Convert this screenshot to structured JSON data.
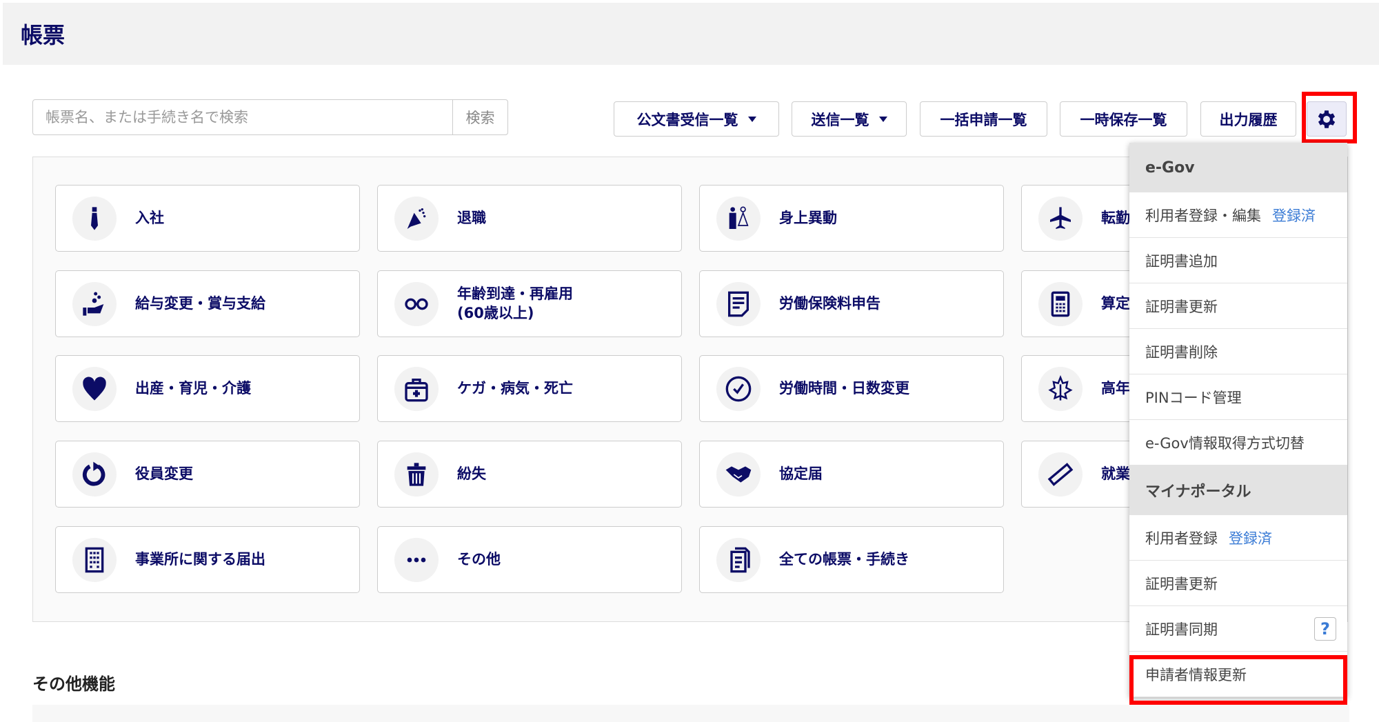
{
  "header": {
    "title": "帳票"
  },
  "search": {
    "placeholder": "帳票名、または手続き名で検索",
    "button": "検索"
  },
  "toolbar": {
    "buttons": [
      {
        "label": "公文書受信一覧",
        "dropdown": true
      },
      {
        "label": "送信一覧",
        "dropdown": true
      },
      {
        "label": "一括申請一覧",
        "dropdown": false
      },
      {
        "label": "一時保存一覧",
        "dropdown": false
      },
      {
        "label": "出力履歴",
        "dropdown": false
      }
    ],
    "settings_icon": "gear-icon"
  },
  "cards": [
    [
      {
        "label": "入社",
        "icon": "tie-icon"
      },
      {
        "label": "退職",
        "icon": "bouquet-icon"
      },
      {
        "label": "身上異動",
        "icon": "couple-icon"
      },
      {
        "label": "転勤",
        "icon": "airplane-icon"
      }
    ],
    [
      {
        "label": "給与変更・賞与支給",
        "icon": "hand-coins-icon"
      },
      {
        "label": "年齢到達・再雇用\n(60歳以上)",
        "icon": "glasses-icon"
      },
      {
        "label": "労働保険料申告",
        "icon": "document-icon"
      },
      {
        "label": "算定",
        "icon": "calculator-icon"
      }
    ],
    [
      {
        "label": "出産・育児・介護",
        "icon": "heart-icon"
      },
      {
        "label": "ケガ・病気・死亡",
        "icon": "first-aid-icon"
      },
      {
        "label": "労働時間・日数変更",
        "icon": "clock-icon"
      },
      {
        "label": "高年",
        "icon": "maple-leaf-icon"
      }
    ],
    [
      {
        "label": "役員変更",
        "icon": "refresh-icon"
      },
      {
        "label": "紛失",
        "icon": "trash-icon"
      },
      {
        "label": "協定届",
        "icon": "handshake-icon"
      },
      {
        "label": "就業",
        "icon": "ruler-icon"
      }
    ],
    [
      {
        "label": "事業所に関する届出",
        "icon": "building-icon"
      },
      {
        "label": "その他",
        "icon": "more-icon"
      },
      {
        "label": "全ての帳票・手続き",
        "icon": "documents-icon"
      }
    ]
  ],
  "other_section": {
    "title": "その他機能"
  },
  "settings_menu": {
    "sections": [
      {
        "title": "e-Gov",
        "items": [
          {
            "label": "利用者登録・編集",
            "badge": "登録済"
          },
          {
            "label": "証明書追加"
          },
          {
            "label": "証明書更新"
          },
          {
            "label": "証明書削除"
          },
          {
            "label": "PINコード管理"
          },
          {
            "label": "e-Gov情報取得方式切替"
          }
        ]
      },
      {
        "title": "マイナポータル",
        "items": [
          {
            "label": "利用者登録",
            "badge": "登録済"
          },
          {
            "label": "証明書更新"
          },
          {
            "label": "証明書同期",
            "help": "?"
          },
          {
            "label": "申請者情報更新",
            "highlighted": true
          }
        ]
      }
    ]
  },
  "colors": {
    "primary": "#0c0c66",
    "badge": "#3a7bd5",
    "highlight": "#ff0000"
  }
}
